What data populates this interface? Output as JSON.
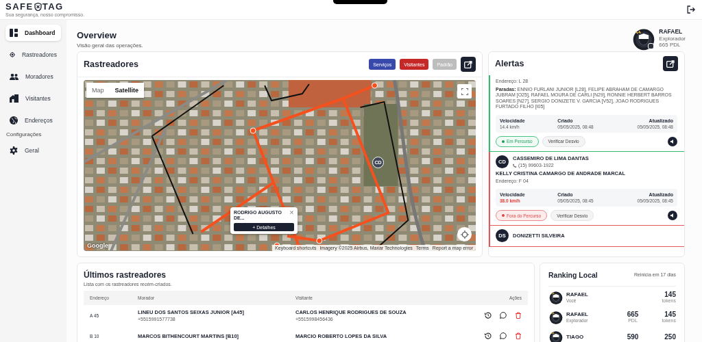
{
  "header": {
    "logo_left": "SAFE",
    "logo_right": "TAG",
    "tagline": "Sua segurança, nosso compromisso."
  },
  "sidebar": {
    "groups": [
      {
        "items": [
          {
            "label": "Dashboard",
            "kind": "dashboard",
            "selected": true
          },
          {
            "label": "Rastreadores",
            "kind": "target",
            "selected": false
          },
          {
            "label": "Moradores",
            "kind": "people",
            "selected": false
          },
          {
            "label": "Visitantes",
            "kind": "house",
            "selected": false
          },
          {
            "label": "Endereços",
            "kind": "globe",
            "selected": false
          }
        ]
      },
      {
        "title": "Configurações",
        "items": [
          {
            "label": "Geral",
            "kind": "gear",
            "selected": false
          }
        ]
      }
    ]
  },
  "page": {
    "title": "Overview",
    "subtitle": "Visão geral das operações."
  },
  "profile": {
    "name": "RAFAEL",
    "rank": "Explorador",
    "points": "665 PDL"
  },
  "trackers_map": {
    "title": "Rastreadores",
    "filters": [
      {
        "label": "Serviços",
        "color": "#3949ab"
      },
      {
        "label": "Visitantes",
        "color": "#c62828"
      },
      {
        "label": "Padrão",
        "color": "#bdbdbd"
      }
    ],
    "map": {
      "types": [
        {
          "label": "Map",
          "selected": false
        },
        {
          "label": "Satellite",
          "selected": true
        }
      ],
      "marker": "CD",
      "popup": {
        "name": "RODRIGO AUGUSTO DE...",
        "action": "+ Detalhes"
      },
      "brand": "Google",
      "attribution": [
        "Keyboard shortcuts",
        "Imagery ©2025 Airbus, Maxar Technologies",
        "Terms",
        "Report a map error"
      ]
    }
  },
  "alerts": {
    "title": "Alertas",
    "items": [
      {
        "kind": "on_route",
        "address": "Endereço: L 28",
        "stops": "**Paradas:** ENNIO FURLANI JUNIOR [L28], FELIPE ABRAHAM DE CAMARGO JUBRAM [O25], RAFAEL MOURA DE CARLI [N29], RONNIE HERBERT BARROS SOARES [N27], SERGIO DONIZETE V. GARCIA [V52], JOAO RODRIGUES FURTADO FILHO [I05]",
        "speed_label": "Velocidade",
        "speed": "14.4 km/h",
        "created_label": "Criado",
        "created": "05/05/2025, 08:48",
        "updated_label": "Atualizado",
        "updated": "05/05/2025, 08:48",
        "status_label": "Em Percurso",
        "check": "Verificar Desvio"
      },
      {
        "kind": "off_route",
        "initials": "CD",
        "resident": "CASSEMIRO DE LIMA DANTAS",
        "phone": "(15) 99603-1922",
        "visitor": "KELLY CRISTINA CAMARGO DE ANDRADE MARCAL",
        "address": "Endereço: F 04",
        "speed_label": "Velocidade",
        "speed": "38.0 km/h",
        "created_label": "Criado",
        "created": "05/05/2025, 08:45",
        "updated_label": "Atualizado",
        "updated": "05/05/2025, 08:45",
        "status_label": "Fora do Percurso",
        "check": "Verificar Desvio"
      },
      {
        "kind": "off_route",
        "initials": "DS",
        "resident": "DONIZETTI SILVEIRA"
      }
    ]
  },
  "latest": {
    "title": "Últimos rastreadores",
    "subtitle": "Lista com os rastreadores recém-criados.",
    "columns": [
      "Endereço",
      "Morador",
      "Visitante",
      "Ações"
    ],
    "rows": [
      {
        "address": "A 45",
        "resident": "LINEU DOS SANTOS SEIXAS JUNIOR [A45]",
        "resident_phone": "+5515991577738",
        "visitor": "CARLOS HENRIQUE RODRIGUES DE SOUZA",
        "visitor_phone": "+5515998456436"
      },
      {
        "address": "B 10",
        "resident": "MARCOS BITHENCOURT MARTINS [B10]",
        "visitor": "MARCIO ROBERTO LOPES DA SILVA"
      }
    ]
  },
  "ranking": {
    "title": "Ranking Local",
    "reset": "Reinicia em 17 dias",
    "rows": [
      {
        "name": "RAFAEL",
        "subtitle": "Você",
        "tokens": "145",
        "tokens_label": "tokens"
      },
      {
        "name": "RAFAEL",
        "subtitle": "Explorador",
        "points": "665",
        "points_label": "PDL",
        "tokens": "145",
        "tokens_label": "tokens"
      },
      {
        "name": "TIAGO",
        "points": "590",
        "tokens": "250"
      }
    ]
  }
}
